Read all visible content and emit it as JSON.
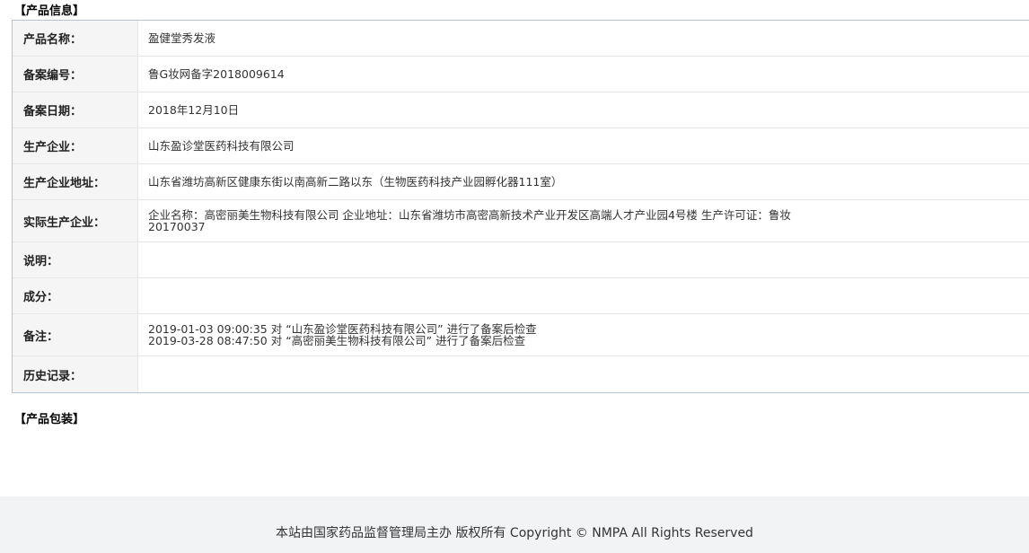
{
  "sections": {
    "product_info_title": "【产品信息】",
    "product_package_title": "【产品包装】"
  },
  "info_rows": [
    {
      "label": "产品名称：",
      "lines": [
        "盈健堂秀发液"
      ]
    },
    {
      "label": "备案编号：",
      "lines": [
        "鲁G妆网备字2018009614"
      ]
    },
    {
      "label": "备案日期：",
      "lines": [
        "2018年12月10日"
      ]
    },
    {
      "label": "生产企业：",
      "lines": [
        "山东盈诊堂医药科技有限公司"
      ]
    },
    {
      "label": "生产企业地址：",
      "lines": [
        "山东省潍坊高新区健康东街以南高新二路以东（生物医药科技产业园孵化器111室）"
      ]
    },
    {
      "label": "实际生产企业：",
      "lines": [
        "企业名称：高密丽美生物科技有限公司 企业地址：山东省潍坊市高密高新技术产业开发区高端人才产业园4号楼 生产许可证：鲁妆",
        "20170037"
      ]
    },
    {
      "label": "说明：",
      "lines": [
        ""
      ]
    },
    {
      "label": "成分：",
      "lines": [
        ""
      ]
    },
    {
      "label": "备注：",
      "lines": [
        "2019-01-03 09:00:35 对 “山东盈诊堂医药科技有限公司” 进行了备案后检查",
        "2019-03-28 08:47:50 对 “高密丽美生物科技有限公司” 进行了备案后检查"
      ]
    },
    {
      "label": "历史记录：",
      "lines": [
        ""
      ]
    }
  ],
  "footer": {
    "text": "本站由国家药品监督管理局主办 版权所有 Copyright © NMPA All Rights Reserved"
  }
}
